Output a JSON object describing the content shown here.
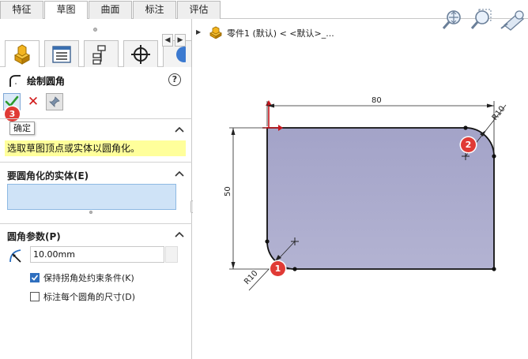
{
  "tabs": [
    {
      "label": "特征",
      "active": false
    },
    {
      "label": "草图",
      "active": true
    },
    {
      "label": "曲面",
      "active": false
    },
    {
      "label": "标注",
      "active": false
    },
    {
      "label": "评估",
      "active": false
    }
  ],
  "property_manager": {
    "title": "绘制圆角",
    "help_icon": "?",
    "cancel_icon": "✕",
    "tooltip": "确定",
    "message": "选取草图顶点或实体以圆角化。",
    "entities_section": {
      "label": "要圆角化的实体(E)"
    },
    "params_section": {
      "label": "圆角参数(P)",
      "radius_value": "10.00mm",
      "keep_constraints": {
        "label": "保持拐角处约束条件(K)",
        "checked": true
      },
      "dimension_each": {
        "label": "标注每个圆角的尺寸(D)",
        "checked": false
      }
    }
  },
  "graphics": {
    "part_label": "零件1 (默认) < <默认>_...",
    "tree_caret": "▶",
    "dimensions": {
      "width": "80",
      "height": "50",
      "fillet_top_right": "R10",
      "fillet_bottom_left": "R10"
    },
    "badges": [
      "1",
      "2",
      "3"
    ]
  },
  "colors": {
    "sketch_fill": "#a8a8cc",
    "badge": "#e03a35",
    "message_bg": "#ffff9b",
    "ok_check": "#2e9a2e",
    "cancel": "#d11a1a"
  }
}
